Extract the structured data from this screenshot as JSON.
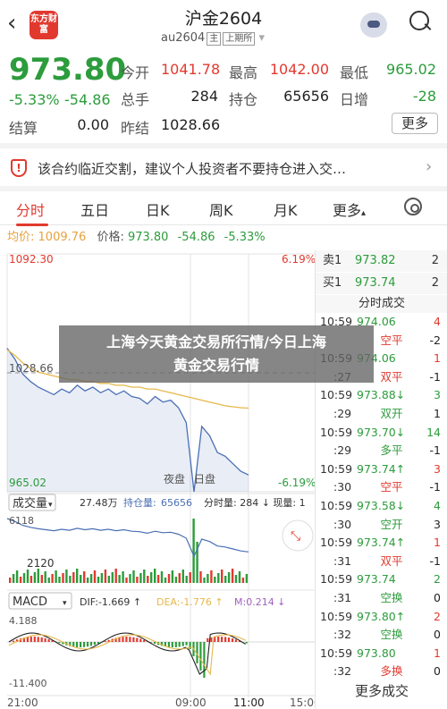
{
  "header": {
    "back_icon": "back-chevron-icon",
    "logo_text": "东方财富",
    "title": "沪金2604",
    "code": "au2604",
    "tag_main": "主",
    "tag_exchange": "上期所",
    "dropdown_icon": "chevron-down-icon",
    "avatar_icon": "robot-assistant-icon",
    "search_icon": "search-icon"
  },
  "quote": {
    "price": "973.80",
    "change_pct": "-5.33%",
    "change": "-54.86",
    "open_label": "今开",
    "open": "1041.78",
    "high_label": "最高",
    "high": "1042.00",
    "low_label": "最低",
    "low": "965.02",
    "volume_label": "总手",
    "volume": "284",
    "oi_label": "持仓",
    "oi": "65656",
    "oi_change_label": "日增",
    "oi_change": "-28",
    "settle_label": "结算",
    "settle": "0.00",
    "prev_settle_label": "昨结",
    "prev_settle": "1028.66",
    "more_label": "更多"
  },
  "notice": {
    "icon": "shield-warning-icon",
    "text": "该合约临近交割，建议个人投资者不要持仓进入交…",
    "arrow": "›"
  },
  "tabs": [
    "分时",
    "五日",
    "日K",
    "周K",
    "月K",
    "更多"
  ],
  "more_tab_arrow": "▴",
  "settings_icon": "gear-icon",
  "infobar": {
    "avg_label": "均价:",
    "avg": "1009.76",
    "price_label": "价格:",
    "price": "973.80",
    "change": "-54.86",
    "pct": "-5.33%"
  },
  "chart": {
    "y_top": "1092.30",
    "y_mid": "1028.66",
    "y_bottom": "965.02",
    "pct_top": "6.19%",
    "pct_bottom": "-6.19%",
    "night_label": "夜盘",
    "day_label": "日盘",
    "vol_label": "成交量",
    "vol_total": "27.48万",
    "oi_label": "持仓量:",
    "oi_value": "65656",
    "vol_detail": "分时量: 284 ↓ 现量: 1",
    "vol_top": "6118",
    "vol_mid": "2120",
    "macd_label": "MACD",
    "dif": "DIF:-1.669 ↑",
    "dea": "DEA:-1.776 ↑",
    "m": "M:0.214 ↓",
    "macd_top": "4.188",
    "macd_bottom": "-11.400",
    "time_start": "21:00",
    "time_mid": "09:00",
    "time_mid2": "11:00",
    "time_end": "15:00",
    "expand_icon": "expand-arrows-icon"
  },
  "chart_data": {
    "type": "line",
    "ylim": [
      965.02,
      1092.3
    ],
    "series": [
      {
        "name": "价格",
        "values": [
          1041.8,
          1036,
          1028,
          1024,
          1021,
          1019,
          1017,
          1020,
          1018,
          1022,
          1019,
          1021,
          1018,
          1020,
          1017,
          1019,
          1016,
          1015,
          1012,
          1016,
          1013,
          1014,
          1010,
          1002,
          965,
          1000,
          995,
          986,
          984,
          980,
          976,
          974
        ]
      },
      {
        "name": "均价",
        "values": [
          1041,
          1038,
          1034,
          1031,
          1029,
          1028,
          1027,
          1026,
          1025,
          1025,
          1024,
          1024,
          1023,
          1023,
          1022,
          1022,
          1021,
          1021,
          1020,
          1020,
          1019,
          1018,
          1017,
          1016,
          1015,
          1014,
          1013,
          1012,
          1011,
          1010.5,
          1010,
          1009.76
        ]
      }
    ]
  },
  "orderbook": [
    {
      "label": "卖1",
      "price": "973.82",
      "vol": "2"
    },
    {
      "label": "买1",
      "price": "973.74",
      "vol": "2"
    }
  ],
  "trades_title": "分时成交",
  "trades": [
    {
      "time": "10:59",
      "price": "974.06",
      "type": "",
      "vol": "4",
      "pc": "green",
      "vc": "red"
    },
    {
      "time": "",
      "price": "",
      "type": "空平",
      "vol": "-2",
      "pc": "green",
      "vc": "dark",
      "tc": "red"
    },
    {
      "time": "10:59",
      "price": "974.06",
      "type": "",
      "vol": "1",
      "pc": "green",
      "vc": "red"
    },
    {
      "time": ":27",
      "price": "",
      "type": "双平",
      "vol": "-1",
      "pc": "green",
      "vc": "dark",
      "tc": "red"
    },
    {
      "time": "10:59",
      "price": "973.88↓",
      "type": "",
      "vol": "3",
      "pc": "green",
      "vc": "green"
    },
    {
      "time": ":29",
      "price": "",
      "type": "双开",
      "vol": "1",
      "pc": "green",
      "vc": "dark",
      "tc": "green"
    },
    {
      "time": "10:59",
      "price": "973.70↓",
      "type": "",
      "vol": "14",
      "pc": "green",
      "vc": "green"
    },
    {
      "time": ":29",
      "price": "",
      "type": "多平",
      "vol": "-1",
      "pc": "green",
      "vc": "dark",
      "tc": "green"
    },
    {
      "time": "10:59",
      "price": "973.74↑",
      "type": "",
      "vol": "3",
      "pc": "green",
      "vc": "red"
    },
    {
      "time": ":30",
      "price": "",
      "type": "空平",
      "vol": "-1",
      "pc": "green",
      "vc": "dark",
      "tc": "red"
    },
    {
      "time": "10:59",
      "price": "973.58↓",
      "type": "",
      "vol": "4",
      "pc": "green",
      "vc": "green"
    },
    {
      "time": ":30",
      "price": "",
      "type": "空开",
      "vol": "3",
      "pc": "green",
      "vc": "dark",
      "tc": "green"
    },
    {
      "time": "10:59",
      "price": "973.74↑",
      "type": "",
      "vol": "1",
      "pc": "green",
      "vc": "red"
    },
    {
      "time": ":31",
      "price": "",
      "type": "双平",
      "vol": "-1",
      "pc": "green",
      "vc": "dark",
      "tc": "red"
    },
    {
      "time": "10:59",
      "price": "973.74",
      "type": "",
      "vol": "2",
      "pc": "green",
      "vc": "green"
    },
    {
      "time": ":31",
      "price": "",
      "type": "空换",
      "vol": "0",
      "pc": "green",
      "vc": "dark",
      "tc": "green"
    },
    {
      "time": "10:59",
      "price": "973.80↑",
      "type": "",
      "vol": "2",
      "pc": "green",
      "vc": "red"
    },
    {
      "time": ":32",
      "price": "",
      "type": "空换",
      "vol": "0",
      "pc": "green",
      "vc": "dark",
      "tc": "green"
    },
    {
      "time": "10:59",
      "price": "973.80",
      "type": "",
      "vol": "1",
      "pc": "green",
      "vc": "red"
    },
    {
      "time": ":32",
      "price": "",
      "type": "多换",
      "vol": "0",
      "pc": "green",
      "vc": "dark",
      "tc": "red"
    }
  ],
  "more_trades": "更多成交",
  "overlay": {
    "line1": "上海今天黄金交易所行情/今日上海",
    "line2": "黄金交易行情"
  },
  "colors": {
    "up": "#e2392f",
    "down": "#2c9c3c",
    "avg": "#e6b84a",
    "line": "#4a6fb5"
  }
}
